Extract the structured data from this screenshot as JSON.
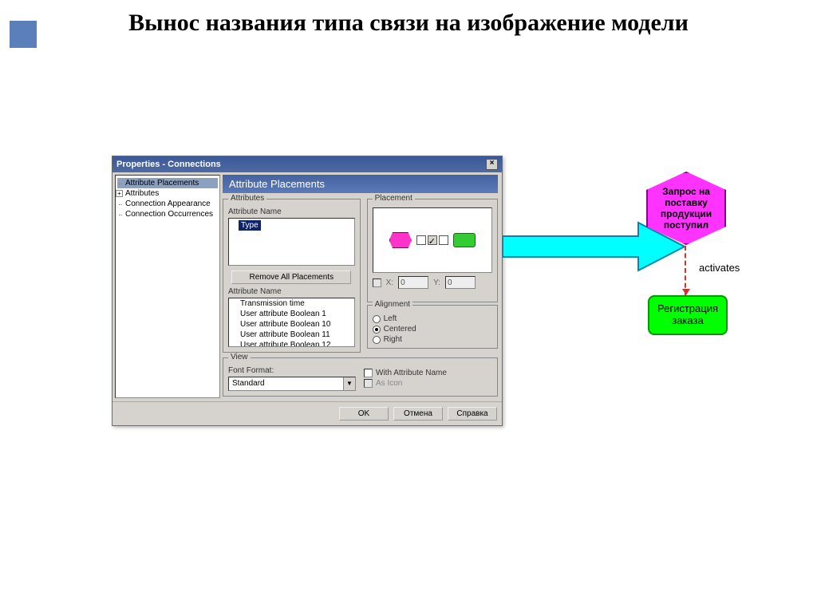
{
  "slide": {
    "title": "Вынос названия типа связи на изображение модели"
  },
  "dialog": {
    "title": "Properties - Connections",
    "tree": [
      "Attribute Placements",
      "Attributes",
      "Connection Appearance",
      "Connection Occurrences"
    ],
    "section_header": "Attribute Placements",
    "attributes_group": "Attributes",
    "attr_name_label": "Attribute Name",
    "selected_attr": "Type",
    "remove_btn": "Remove All Placements",
    "attr_list": [
      "Transmission time",
      "User attribute Boolean 1",
      "User attribute Boolean 10",
      "User attribute Boolean 11",
      "User attribute Boolean 12"
    ],
    "placement_group": "Placement",
    "x_label": "X:",
    "y_label": "Y:",
    "x_val": "0",
    "y_val": "0",
    "alignment_group": "Alignment",
    "align": {
      "left": "Left",
      "centered": "Centered",
      "right": "Right"
    },
    "view_group": "View",
    "font_label": "Font Format:",
    "font_value": "Standard",
    "with_attr_name": "With Attribute Name",
    "as_icon": "As Icon",
    "buttons": {
      "ok": "OK",
      "cancel": "Отмена",
      "help": "Справка"
    }
  },
  "diagram": {
    "hex_text": "Запрос на поставку продукции поступил",
    "activates": "activates",
    "green_text": "Регистрация заказа"
  }
}
